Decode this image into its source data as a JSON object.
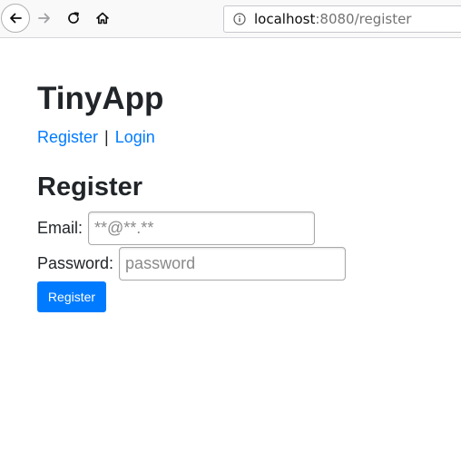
{
  "browser": {
    "url_host": "localhost",
    "url_rest": ":8080/register",
    "icons": {
      "back": "back-arrow-icon",
      "forward": "forward-arrow-icon",
      "reload": "reload-icon",
      "home": "home-icon",
      "info": "info-icon"
    }
  },
  "app": {
    "title": "TinyApp",
    "nav": {
      "register": "Register",
      "separator": "|",
      "login": "Login"
    }
  },
  "form": {
    "heading": "Register",
    "email_label": "Email:",
    "email_placeholder": "**@**.**",
    "email_value": "",
    "password_label": "Password:",
    "password_placeholder": "password",
    "password_value": "",
    "submit_label": "Register"
  },
  "colors": {
    "link": "#007bff",
    "button_bg": "#007bff",
    "text": "#212529"
  }
}
